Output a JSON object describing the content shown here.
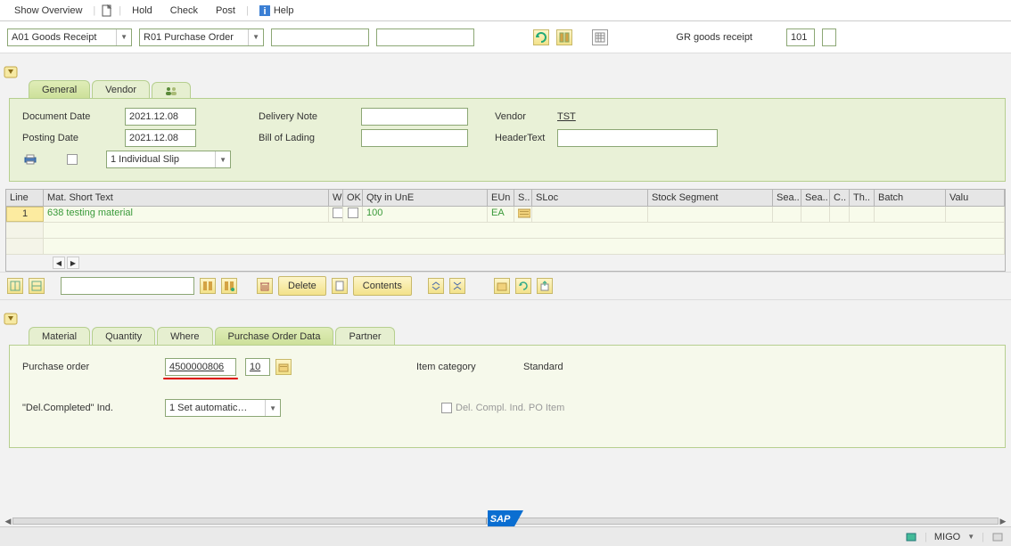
{
  "toolbar": {
    "show_overview": "Show Overview",
    "hold": "Hold",
    "check": "Check",
    "post": "Post",
    "help": "Help"
  },
  "selectors": {
    "action": "A01 Goods Receipt",
    "ref": "R01 Purchase Order",
    "gr_label": "GR goods receipt",
    "gr_code": "101"
  },
  "tabs_header": {
    "general": "General",
    "vendor": "Vendor"
  },
  "general": {
    "document_date_lbl": "Document Date",
    "document_date": "2021.12.08",
    "posting_date_lbl": "Posting Date",
    "posting_date": "2021.12.08",
    "delivery_note_lbl": "Delivery Note",
    "delivery_note": "",
    "bill_of_lading_lbl": "Bill of Lading",
    "bill_of_lading": "",
    "vendor_lbl": "Vendor",
    "vendor_val": "TST",
    "header_text_lbl": "HeaderText",
    "header_text": "",
    "slip_option": "1 Individual Slip"
  },
  "table": {
    "cols": {
      "line": "Line",
      "mat": "Mat. Short Text",
      "w": "W",
      "ok": "OK",
      "qty": "Qty in UnE",
      "eun": "EUn",
      "s": "S..",
      "sloc": "SLoc",
      "stockseg": "Stock Segment",
      "sea1": "Sea..",
      "sea2": "Sea..",
      "c": "C..",
      "th": "Th..",
      "batch": "Batch",
      "valu": "Valu"
    },
    "rows": [
      {
        "line": "1",
        "mat": "638 testing material",
        "qty": "100",
        "eun": "EA"
      }
    ]
  },
  "actions": {
    "delete": "Delete",
    "contents": "Contents"
  },
  "tabs_item": {
    "material": "Material",
    "quantity": "Quantity",
    "where": "Where",
    "po_data": "Purchase Order Data",
    "partner": "Partner"
  },
  "po_panel": {
    "po_lbl": "Purchase order",
    "po_num": "4500000806",
    "po_item": "10",
    "item_cat_lbl": "Item category",
    "item_cat_val": "Standard",
    "del_compl_lbl": "\"Del.Completed\" Ind.",
    "del_compl_dd": "1 Set automatic…",
    "del_compl_po_item": "Del. Compl. Ind. PO Item"
  },
  "status": {
    "tcode": "MIGO"
  }
}
